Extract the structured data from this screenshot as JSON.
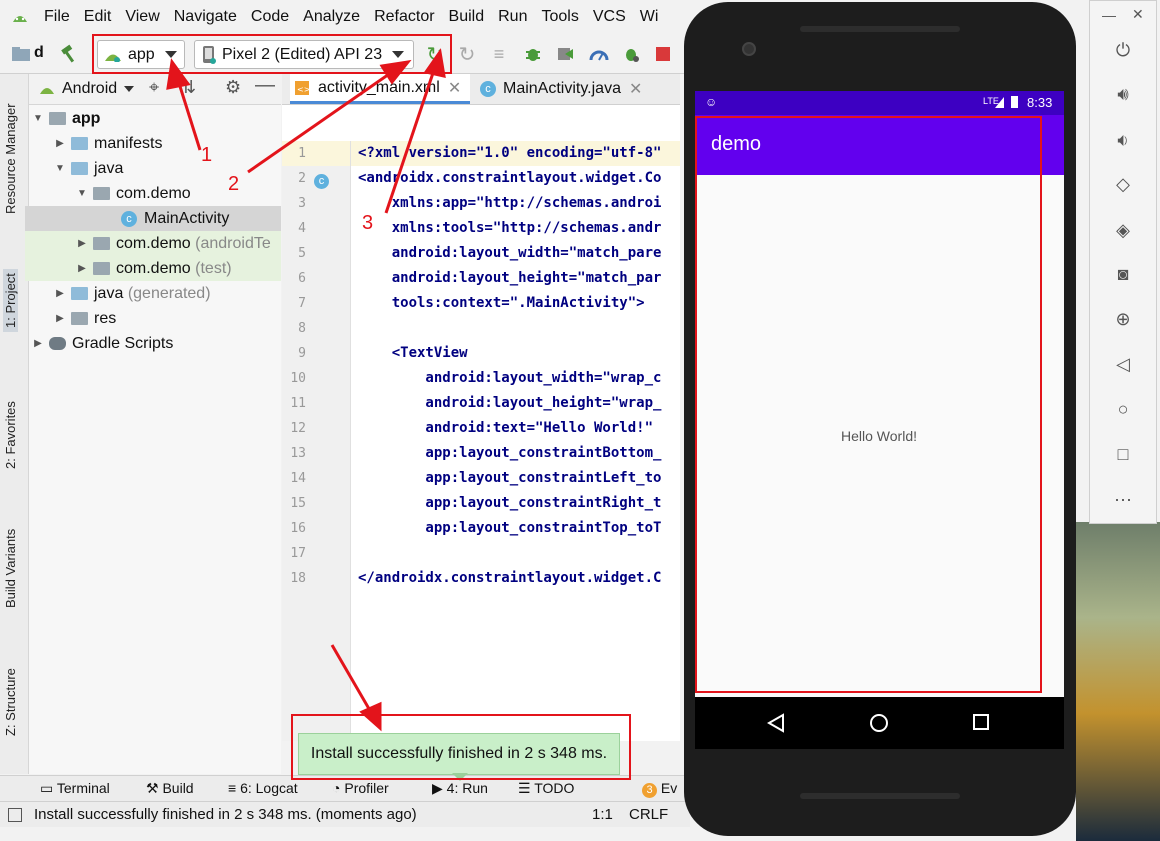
{
  "menu": [
    "File",
    "Edit",
    "View",
    "Navigate",
    "Code",
    "Analyze",
    "Refactor",
    "Build",
    "Run",
    "Tools",
    "VCS",
    "Wi"
  ],
  "toolbar": {
    "project_initial": "d",
    "run_config": "app",
    "device": "Pixel 2 (Edited) API 23"
  },
  "left_stripe": {
    "resource_manager": "Resource Manager",
    "project": "1: Project",
    "favorites": "2: Favorites",
    "build_variants": "Build Variants",
    "structure": "Z: Structure"
  },
  "project_panel": {
    "view_mode": "Android",
    "tree": [
      {
        "label": "app",
        "extra": ""
      },
      {
        "label": "manifests",
        "extra": ""
      },
      {
        "label": "java",
        "extra": ""
      },
      {
        "label": "com.demo",
        "extra": ""
      },
      {
        "label": "MainActivity",
        "extra": ""
      },
      {
        "label": "com.demo",
        "extra": "(androidTe"
      },
      {
        "label": "com.demo",
        "extra": "(test)"
      },
      {
        "label": "java",
        "extra": "(generated)"
      },
      {
        "label": "res",
        "extra": ""
      },
      {
        "label": "Gradle Scripts",
        "extra": ""
      }
    ]
  },
  "editor": {
    "tabs": [
      {
        "label": "activity_main.xml"
      },
      {
        "label": "MainActivity.java"
      }
    ],
    "line_numbers": [
      "1",
      "2",
      "3",
      "4",
      "5",
      "6",
      "7",
      "8",
      "9",
      "10",
      "11",
      "12",
      "13",
      "14",
      "15",
      "16",
      "17",
      "18"
    ],
    "lines": [
      "<?xml version=\"1.0\" encoding=\"utf-8\"",
      "<androidx.constraintlayout.widget.Co",
      "    xmlns:app=\"http://schemas.androi",
      "    xmlns:tools=\"http://schemas.andr",
      "    android:layout_width=\"match_pare",
      "    android:layout_height=\"match_par",
      "    tools:context=\".MainActivity\">",
      "",
      "    <TextView",
      "        android:layout_width=\"wrap_c",
      "        android:layout_height=\"wrap_",
      "        android:text=\"Hello World!\"",
      "        app:layout_constraintBottom_",
      "        app:layout_constraintLeft_to",
      "        app:layout_constraintRight_t",
      "        app:layout_constraintTop_toT",
      "",
      "</androidx.constraintlayout.widget.C"
    ]
  },
  "bottom_tools": {
    "terminal": "Terminal",
    "build": "Build",
    "logcat": "6: Logcat",
    "profiler": "Profiler",
    "run": "4: Run",
    "todo": "TODO",
    "event_badge": "3",
    "event": "Ev"
  },
  "toast": "Install successfully finished in 2 s 348 ms.",
  "status": {
    "message": "Install successfully finished in 2 s 348 ms. (moments ago)",
    "position": "1:1",
    "line_sep": "CRLF"
  },
  "annotations": {
    "a1": "1",
    "a2": "2",
    "a3": "3"
  },
  "emulator": {
    "time": "8:33",
    "network": "LTE",
    "app_title": "demo",
    "content_text": "Hello World!",
    "colors": {
      "app_bar": "#6200ee",
      "status_bar": "#3d00c2"
    }
  }
}
